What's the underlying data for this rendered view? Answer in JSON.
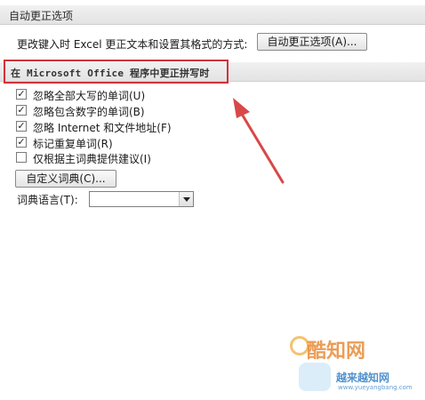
{
  "sections": {
    "autocorrect_header": "自动更正选项",
    "spelling_header": "在 Microsoft Office 程序中更正拼写时"
  },
  "autocorrect": {
    "description": "更改键入时 Excel 更正文本和设置其格式的方式:",
    "button_label": "自动更正选项(A)..."
  },
  "spelling": {
    "options": [
      {
        "label": "忽略全部大写的单词(U)",
        "checked": true
      },
      {
        "label": "忽略包含数字的单词(B)",
        "checked": true
      },
      {
        "label": "忽略 Internet 和文件地址(F)",
        "checked": true
      },
      {
        "label": "标记重复单词(R)",
        "checked": true
      },
      {
        "label": "仅根据主词典提供建议(I)",
        "checked": false
      }
    ],
    "custom_dict_label": "自定义词典(C)...",
    "language_label": "词典语言(T):",
    "language_value": ""
  },
  "watermark": {
    "title": "酷知网",
    "subtitle": "越来越知网",
    "url": "www.yueyangbang.com"
  },
  "colors": {
    "highlight": "#d2323a",
    "arrow": "#d94848"
  }
}
